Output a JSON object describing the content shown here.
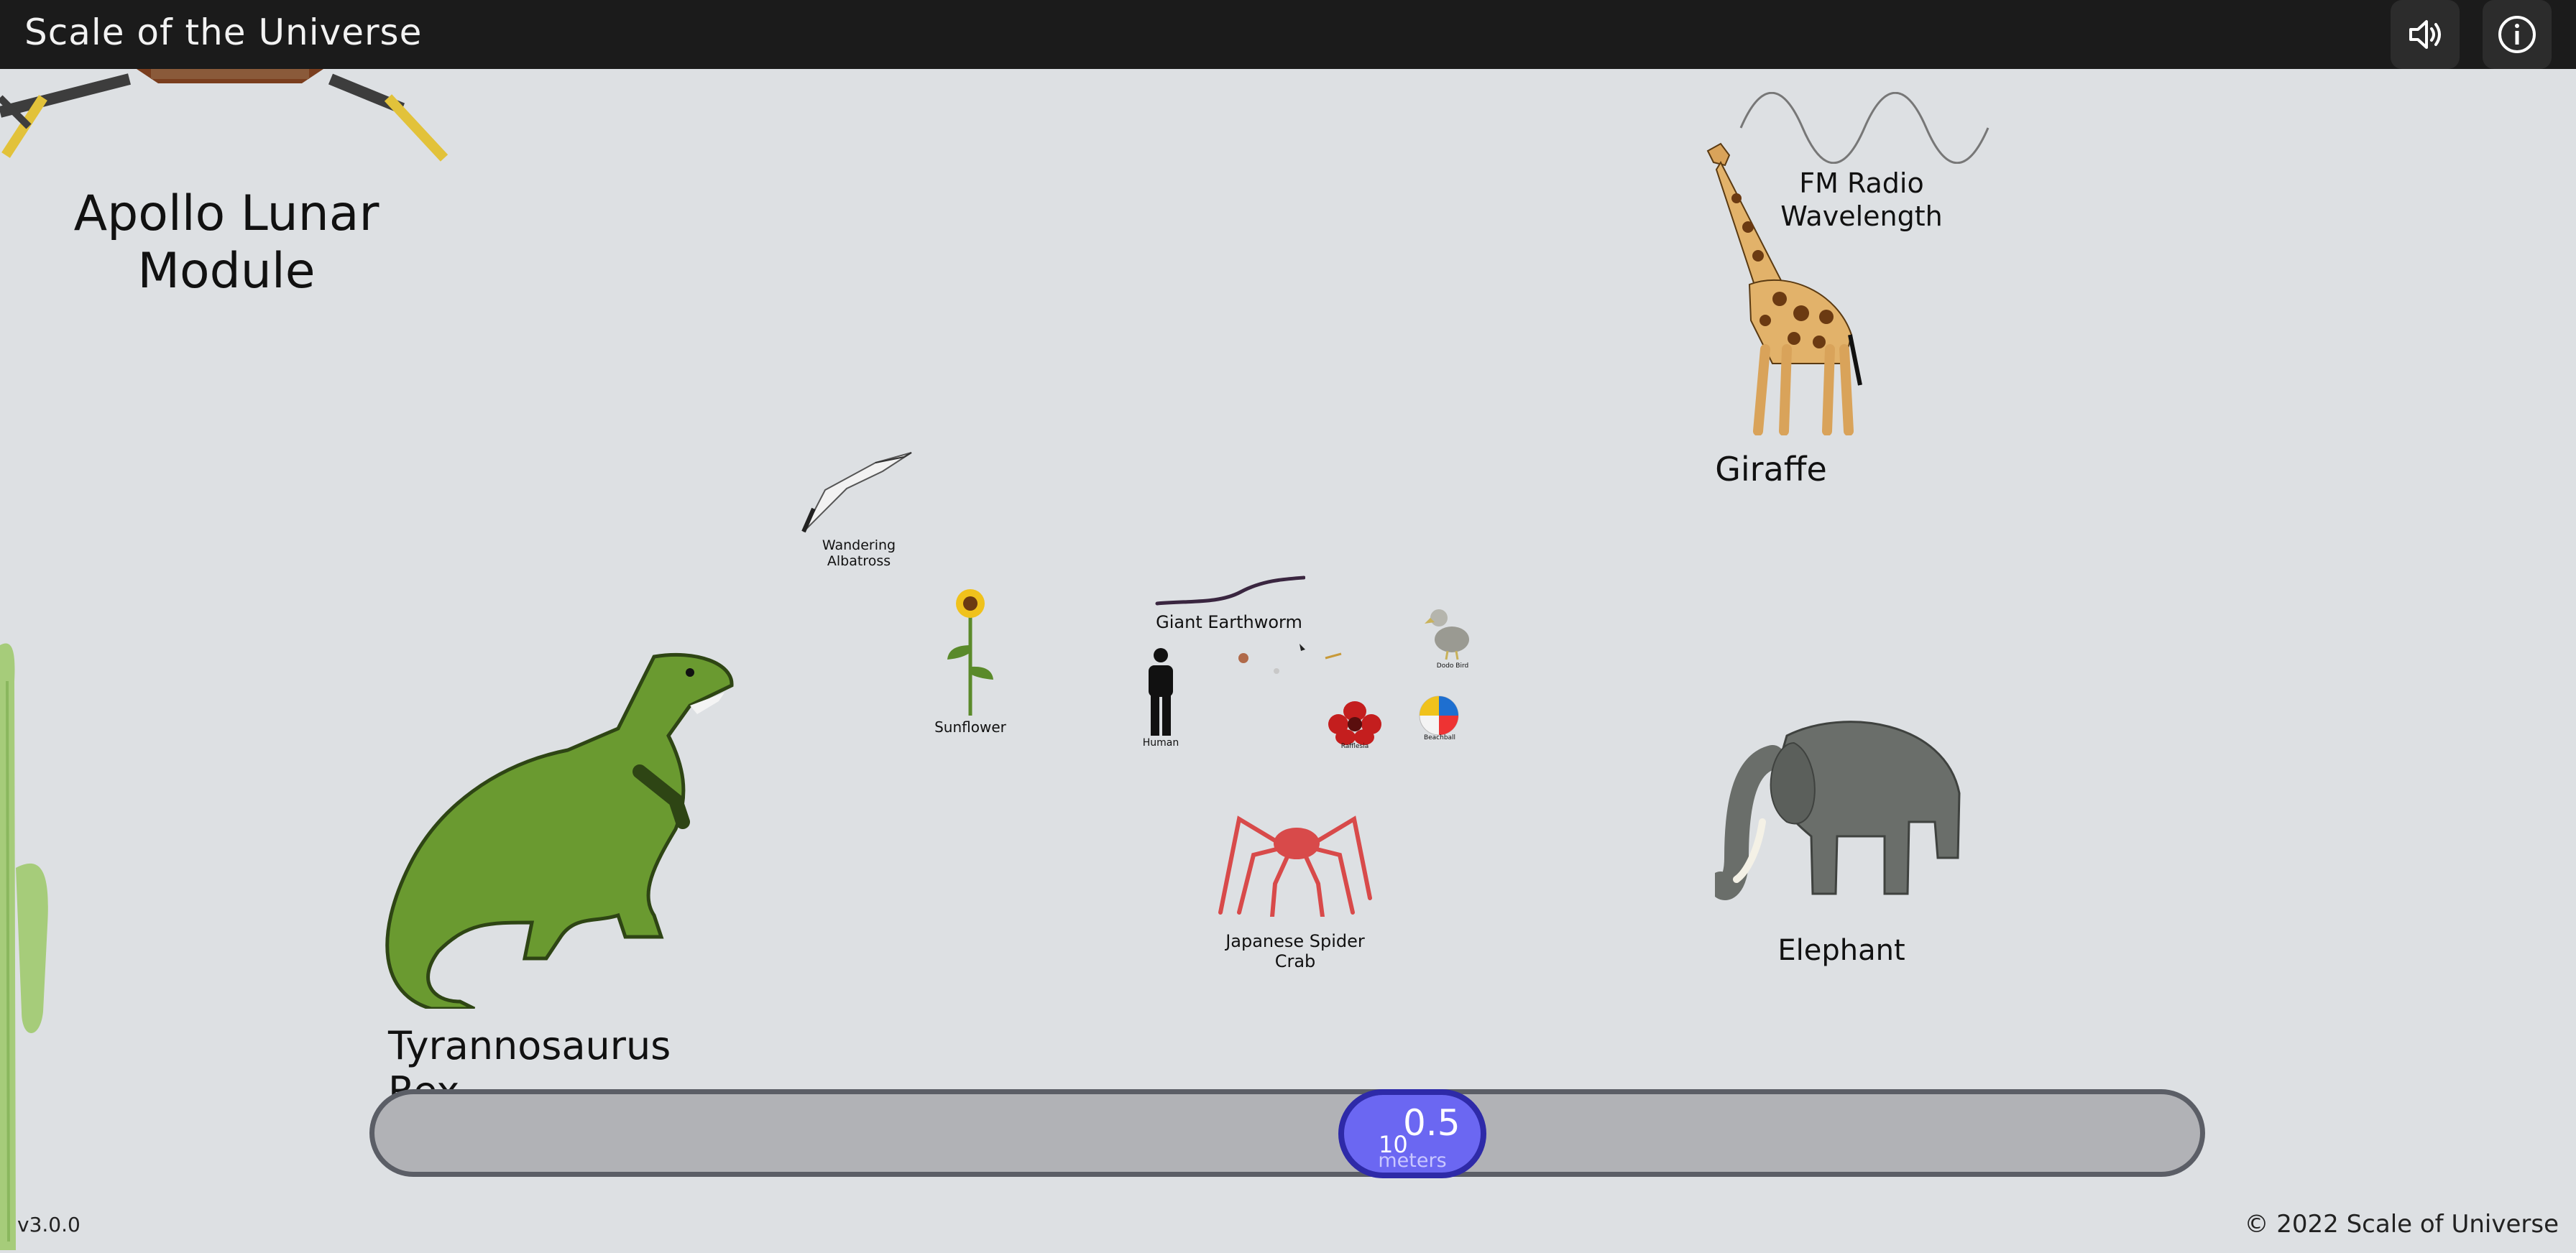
{
  "app": {
    "title": "Scale of the Universe",
    "version": "v3.0.0",
    "copyright": "© 2022 Scale of Universe"
  },
  "toolbar": {
    "sound_icon": "speaker-icon",
    "info_icon": "info-icon"
  },
  "objects": {
    "apollo": "Apollo Lunar\nModule",
    "fm_radio": "FM Radio\nWavelength",
    "giraffe": "Giraffe",
    "albatross": "Wandering\nAlbatross",
    "earthworm": "Giant Earthworm",
    "sunflower": "Sunflower",
    "human": "Human",
    "rafflesia": "Rafflesia",
    "beachball": "Beachball",
    "dodo": "Dodo Bird",
    "spider_crab": "Japanese Spider\nCrab",
    "elephant": "Elephant",
    "trex": "Tyrannosaurus Rex"
  },
  "slider": {
    "base": "10",
    "exponent": "0.5",
    "unit": "meters",
    "position_fraction": 0.566
  },
  "colors": {
    "accent": "#6b67f2",
    "accent_border": "#2e2aa8",
    "topbar": "#1b1b1b",
    "background": "#dde0e3"
  }
}
